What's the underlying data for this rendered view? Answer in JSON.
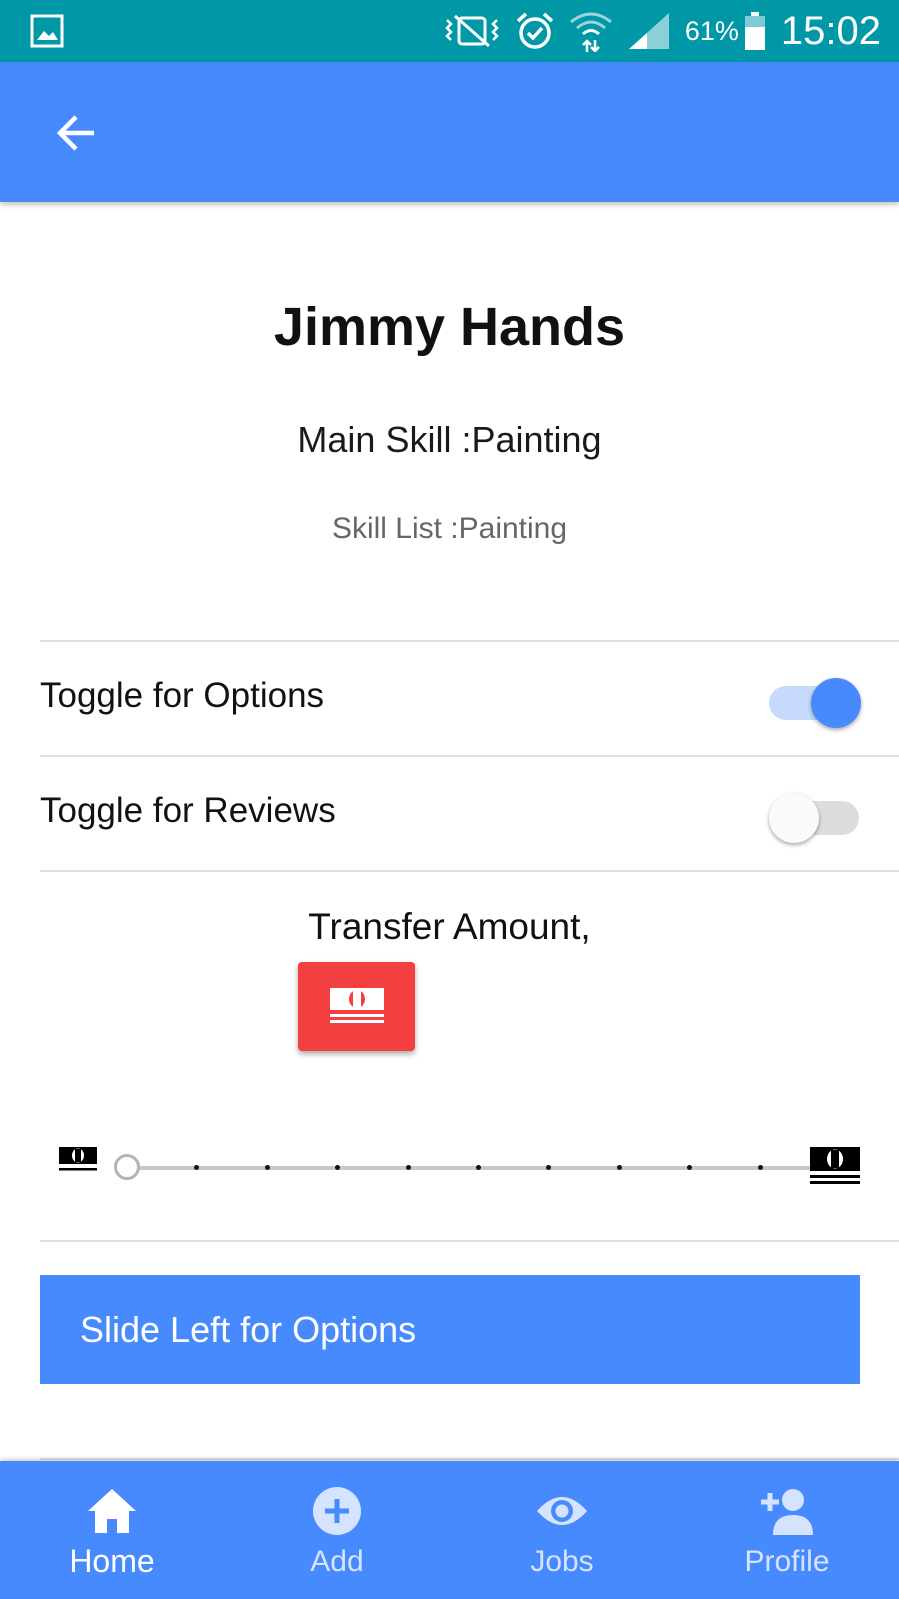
{
  "status_bar": {
    "battery_percent": "61%",
    "time": "15:02",
    "icons": [
      "gallery-icon",
      "vibrate-icon",
      "alarm-icon",
      "wifi-icon",
      "signal-icon",
      "battery-icon"
    ]
  },
  "app_bar": {
    "back_icon": "arrow-left-icon"
  },
  "profile": {
    "name": "Jimmy Hands",
    "main_skill": "Main Skill :Painting",
    "skill_list": "Skill List :Painting"
  },
  "toggles": [
    {
      "label": "Toggle for Options",
      "on": true
    },
    {
      "label": "Toggle for Reviews",
      "on": false
    }
  ],
  "transfer": {
    "label": "Transfer Amount,",
    "button_icon": "money-icon"
  },
  "slider": {
    "min_icon": "money-icon",
    "max_icon": "money-icon",
    "value": 0,
    "steps": 10
  },
  "slide_button": {
    "label": "Slide Left for Options"
  },
  "bottom_nav": {
    "items": [
      {
        "label": "Home",
        "icon": "home-icon",
        "active": true
      },
      {
        "label": "Add",
        "icon": "add-circle-icon",
        "active": false
      },
      {
        "label": "Jobs",
        "icon": "eye-icon",
        "active": false
      },
      {
        "label": "Profile",
        "icon": "person-add-icon",
        "active": false
      }
    ]
  },
  "colors": {
    "primary": "#478afe",
    "status_bar": "#0097a7",
    "money_button": "#f33f3f"
  }
}
